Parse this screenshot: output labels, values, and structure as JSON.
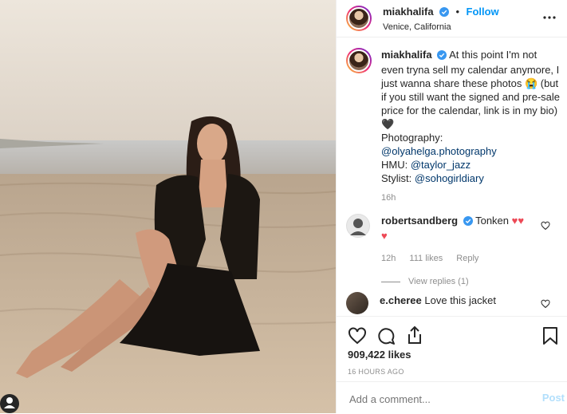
{
  "user": {
    "username": "miakhalifa",
    "location": "Venice, California",
    "follow_label": "Follow",
    "dot": "•"
  },
  "caption": {
    "username": "miakhalifa",
    "text": "At this point I'm not even tryna sell my calendar anymore, I just wanna share these photos 😭 (but if you still want the signed and pre-sale price for the calendar, link is in my bio) 🖤",
    "photography_label": "Photography:",
    "photography_link": "@olyahelga.photography",
    "hmu_label": "HMU:",
    "hmu_link": "@taylor_jazz",
    "stylist_label": "Stylist:",
    "stylist_link": "@sohogirldiary",
    "time": "16h"
  },
  "comments": [
    {
      "username": "robertsandberg",
      "text": "Tonken ♥♥ ♥",
      "time": "12h",
      "likes": "111 likes",
      "reply": "Reply",
      "view_replies": "View replies (1)"
    },
    {
      "username": "e.cheree",
      "text": "Love this jacket"
    }
  ],
  "stats": {
    "likes": "909,422 likes",
    "posted": "16 HOURS AGO"
  },
  "composer": {
    "placeholder": "Add a comment...",
    "post_label": "Post"
  },
  "colors": {
    "accent": "#0095f6",
    "link": "#00376b",
    "heart": "#ed4956",
    "muted": "#8e8e8e"
  }
}
